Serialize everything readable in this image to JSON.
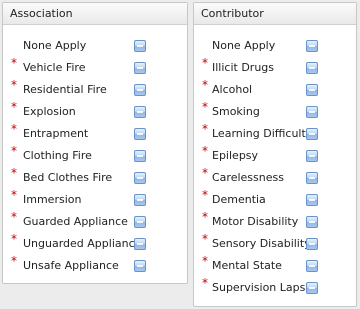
{
  "association": {
    "title": "Association",
    "items": [
      {
        "label": "None Apply",
        "required": false
      },
      {
        "label": "Vehicle Fire",
        "required": true
      },
      {
        "label": "Residential Fire",
        "required": true
      },
      {
        "label": "Explosion",
        "required": true
      },
      {
        "label": "Entrapment",
        "required": true
      },
      {
        "label": "Clothing Fire",
        "required": true
      },
      {
        "label": "Bed Clothes Fire",
        "required": true
      },
      {
        "label": "Immersion",
        "required": true
      },
      {
        "label": "Guarded Appliance",
        "required": true
      },
      {
        "label": "Unguarded Appliance",
        "required": true
      },
      {
        "label": "Unsafe Appliance",
        "required": true
      }
    ]
  },
  "contributor": {
    "title": "Contributor",
    "items": [
      {
        "label": "None Apply",
        "required": false
      },
      {
        "label": "Illicit Drugs",
        "required": true
      },
      {
        "label": "Alcohol",
        "required": true
      },
      {
        "label": "Smoking",
        "required": true
      },
      {
        "label": "Learning Difficulty",
        "required": true
      },
      {
        "label": "Epilepsy",
        "required": true
      },
      {
        "label": "Carelessness",
        "required": true
      },
      {
        "label": "Dementia",
        "required": true
      },
      {
        "label": "Motor Disability",
        "required": true
      },
      {
        "label": "Sensory Disability",
        "required": true
      },
      {
        "label": "Mental State",
        "required": true
      },
      {
        "label": "Supervision Lapse",
        "required": true
      }
    ]
  },
  "required_marker": "*",
  "colors": {
    "required": "#c40000",
    "checkbox": "#8fb5e6"
  }
}
